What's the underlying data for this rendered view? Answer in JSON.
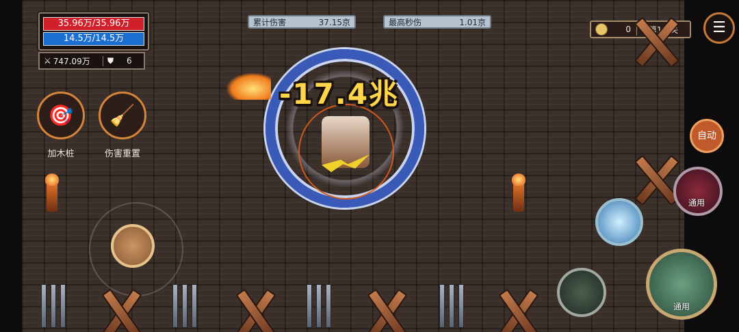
{
  "hud": {
    "hp": "35.96万/35.96万",
    "mp": "14.5万/14.5万",
    "attack": "747.09万",
    "defense": "6"
  },
  "damage": {
    "total_label": "累计伤害",
    "total_value": "37.15京",
    "max_label": "最高秒伤",
    "max_value": "1.01京"
  },
  "stage": {
    "coins": "0",
    "level": "第1/1关"
  },
  "skills": {
    "add_dummy": "加木桩",
    "reset_damage": "伤害重置"
  },
  "combat": {
    "damage_popup": "-17.4兆"
  },
  "buttons": {
    "auto": "自动",
    "general_1": "通用",
    "general_2": "通用"
  },
  "colors": {
    "hp_bar": "#d0202a",
    "mp_bar": "#1a6fd0",
    "accent": "#d6863a"
  },
  "icons": {
    "attack": "sword-icon",
    "defense": "shield-icon",
    "coin": "coin-icon",
    "menu": "menu-icon"
  }
}
